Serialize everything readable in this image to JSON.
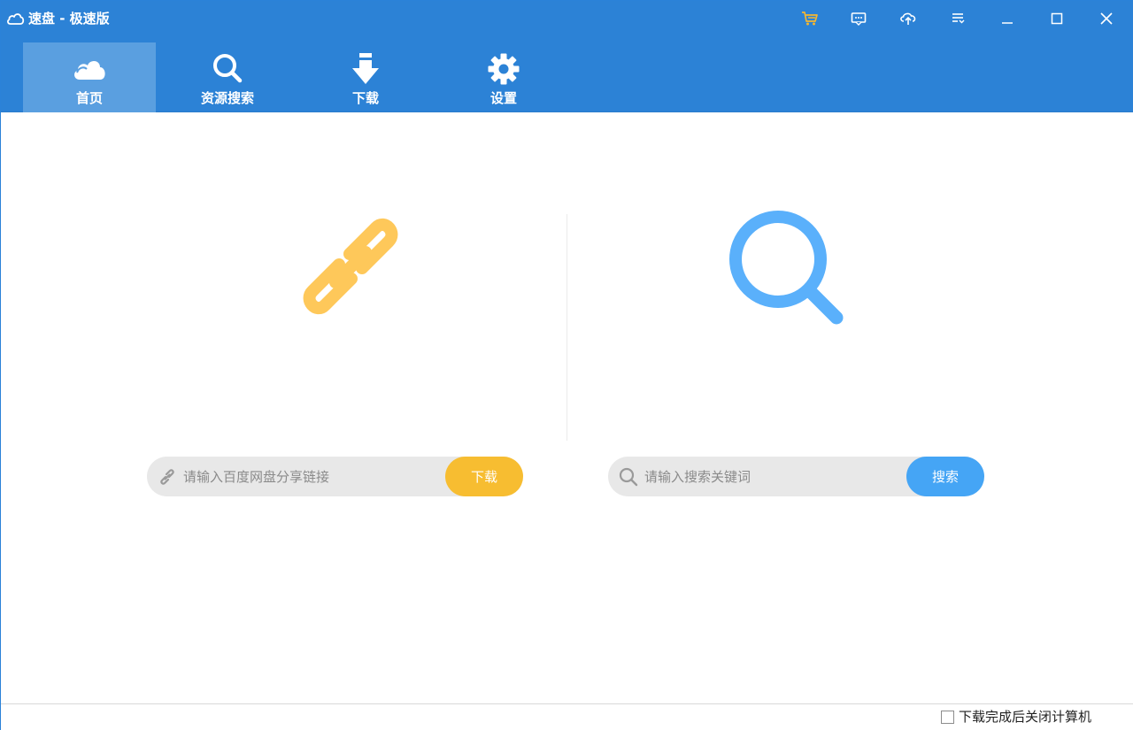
{
  "window": {
    "title": "速盘 - 极速版"
  },
  "titlebar_buttons": [
    {
      "name": "cart-icon",
      "color": "#f5b731"
    },
    {
      "name": "message-icon",
      "color": "#ffffff"
    },
    {
      "name": "upload-cloud-icon",
      "color": "#ffffff"
    },
    {
      "name": "menu-list-icon",
      "color": "#ffffff"
    },
    {
      "name": "minimize-icon",
      "color": "#ffffff"
    },
    {
      "name": "maximize-icon",
      "color": "#ffffff"
    },
    {
      "name": "close-icon",
      "color": "#ffffff"
    }
  ],
  "tabs": [
    {
      "label": "首页",
      "icon": "cloud-icon",
      "active": true
    },
    {
      "label": "资源搜索",
      "icon": "search-icon",
      "active": false
    },
    {
      "label": "下载",
      "icon": "download-arrow-icon",
      "active": false
    },
    {
      "label": "设置",
      "icon": "gear-icon",
      "active": false
    }
  ],
  "link_panel": {
    "icon": "link-icon",
    "placeholder": "请输入百度网盘分享链接",
    "button_label": "下载",
    "accent": "#f7bd31"
  },
  "search_panel": {
    "icon": "magnifier-icon",
    "placeholder": "请输入搜索关键词",
    "button_label": "搜索",
    "accent": "#45a5f5"
  },
  "footer": {
    "shutdown_label": "下载完成后关闭计算机",
    "shutdown_checked": false
  },
  "colors": {
    "header_bg": "#2c82d6",
    "active_tab_bg": "#5a9fe0",
    "link_icon": "#fec85a",
    "search_icon": "#5ab0fb",
    "pill_bg": "#e8e8e8"
  }
}
